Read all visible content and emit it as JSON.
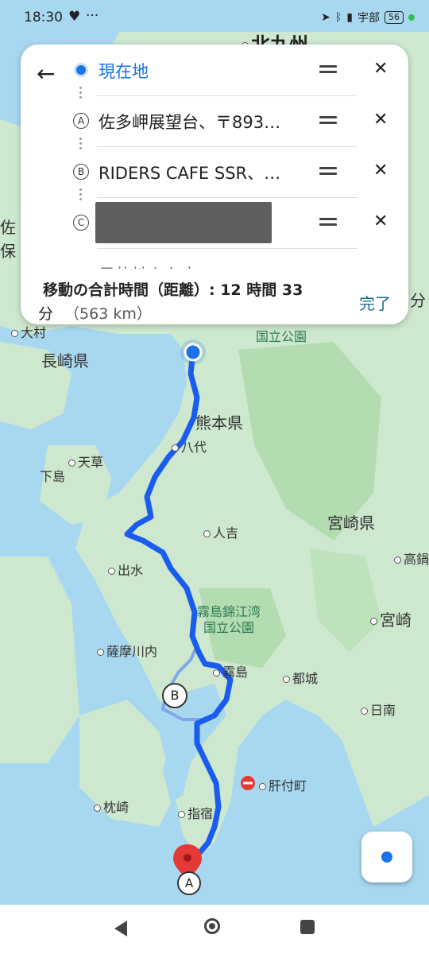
{
  "status_bar": {
    "time": "18:30",
    "heart": "♥",
    "more": "···",
    "right_text": "宇部",
    "battery": "56"
  },
  "route_card": {
    "stops": [
      {
        "marker": "current-location",
        "label": "現在地"
      },
      {
        "marker": "A",
        "label": "佐多岬展望台、〒893…"
      },
      {
        "marker": "B",
        "label": "RIDERS CAFE SSR、…"
      },
      {
        "marker": "C",
        "label": ""
      },
      {
        "marker": "destination",
        "label": "目的地を入力"
      }
    ],
    "summary_line1": "移動の合計時間（距離）: 12 時間 33",
    "summary_line2": "分",
    "summary_distance": "（563 km）",
    "done_label": "完了",
    "close_glyph": "✕",
    "back_glyph": "←"
  },
  "map": {
    "labels": {
      "kitakyushu": "北九州",
      "nagasaki": "長崎県",
      "omura": "大村",
      "ho": "保",
      "sa": "佐",
      "fun": "分",
      "kokuritsu": "国立公園",
      "kumamoto": "熊本県",
      "yatsushiro": "八代",
      "amakusa": "天草",
      "shimojima": "下島",
      "hitoyoshi": "人吉",
      "miyazaki_pref": "宮崎県",
      "izumi": "出水",
      "takanabe": "高鍋",
      "kirishima_park": "霧島錦江湾\n国立公園",
      "miyazaki": "宮崎",
      "satsumasendai": "薩摩川内",
      "kirishima": "霧島",
      "miyakonojo": "都城",
      "nichinan": "日南",
      "kimotsuki": "肝付町",
      "makurazaki": "枕崎",
      "ibusuki": "指宿"
    },
    "map_markers": {
      "b": "B",
      "a": "A"
    },
    "colors": {
      "route": "#1a5cf0",
      "route_alt": "#7fa7e8",
      "water": "#a8d8f0",
      "land": "#cde8cf",
      "pin_red": "#e53935"
    }
  },
  "nav": {
    "back_glyph": "◀"
  }
}
